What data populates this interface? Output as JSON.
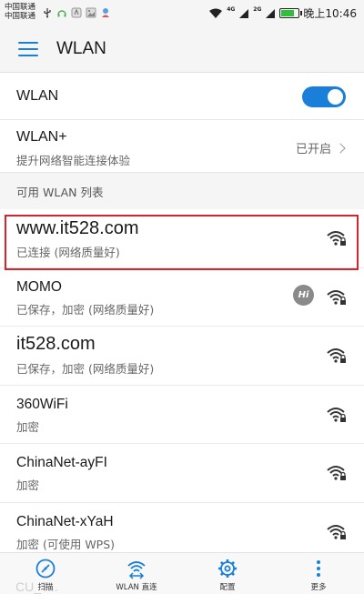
{
  "status_bar": {
    "carrier_1": "中国联通",
    "carrier_2": "中国联通",
    "net_tag_1": "4G",
    "net_tag_2": "2G",
    "battery_level": 0.85,
    "time": "晚上10:46"
  },
  "header": {
    "title": "WLAN"
  },
  "wlan_toggle": {
    "label": "WLAN",
    "enabled": true
  },
  "wlan_plus": {
    "title": "WLAN+",
    "subtitle": "提升网络智能连接体验",
    "status": "已开启"
  },
  "section": {
    "title": "可用 WLAN 列表"
  },
  "networks": [
    {
      "name": "www.it528.com",
      "status": "已连接 (网络质量好)",
      "locked": true
    },
    {
      "name": "MOMO",
      "status": "已保存，加密 (网络质量好)",
      "locked": true,
      "badge": "Hi"
    },
    {
      "name": "it528.com",
      "status": "已保存，加密 (网络质量好)",
      "locked": true
    },
    {
      "name": "360WiFi",
      "status": "加密",
      "locked": true
    },
    {
      "name": "ChinaNet-ayFI",
      "status": "加密",
      "locked": true
    },
    {
      "name": "ChinaNet-xYaH",
      "status": "加密 (可使用 WPS)",
      "locked": true
    }
  ],
  "bottom_bar": {
    "ghost": "CU_T...",
    "scan": "扫描",
    "direct": "WLAN 直连",
    "config": "配置",
    "more": "更多"
  },
  "colors": {
    "accent": "#1a7fd8",
    "highlight": "#d4242c"
  }
}
